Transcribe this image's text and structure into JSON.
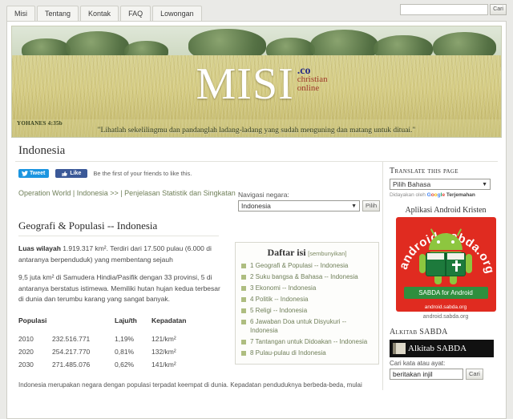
{
  "nav": {
    "tabs": [
      "Misi",
      "Tentang",
      "Kontak",
      "FAQ",
      "Lowongan"
    ],
    "search_value": "",
    "search_placeholder": "",
    "search_button": "Cari"
  },
  "banner": {
    "logo": "MISI",
    "logo_tld": ".co",
    "logo_tagline_1": "christian",
    "logo_tagline_2": "online",
    "verse_ref": "YOHANES 4:35b",
    "verse_text": "\"Lihatlah sekelilingmu dan pandanglah ladang-ladang yang sudah menguning dan matang untuk dituai.\""
  },
  "page": {
    "title": "Indonesia"
  },
  "social": {
    "tweet_label": "Tweet",
    "like_label": "Like",
    "note": "Be the first of your friends to like this."
  },
  "breadcrumb": {
    "item_1": "Operation World",
    "sep_1": " | ",
    "item_2": "Indonesia >>",
    "sep_2": " | ",
    "item_3": "Penjelasan Statistik dan Singkatan"
  },
  "country_nav": {
    "label": "Navigasi negara:",
    "selected": "Indonesia",
    "button": "Pilih"
  },
  "article": {
    "section_title": "Geografi & Populasi -- Indonesia",
    "para1_bold": "Luas wilayah",
    "para1_rest": " 1.919.317 km². Terdiri dari 17.500 pulau (6.000 di antaranya berpenduduk) yang membentang sejauh",
    "para2": "9,5 juta km² di Samudera Hindia/Pasifik dengan 33 provinsi, 5 di antaranya berstatus istimewa. Memiliki hutan hujan kedua terbesar di dunia dan terumbu karang yang sangat banyak.",
    "bottom_para": "Indonesia merupakan negara dengan populasi terpadat keempat di dunia. Kepadatan penduduknya berbeda-beda, mulai"
  },
  "table": {
    "headers": [
      "Populasi",
      "Laju/th",
      "Kepadatan"
    ],
    "rows": [
      {
        "year": "2010",
        "population": "232.516.771",
        "rate": "1,19%",
        "density": "121/km²"
      },
      {
        "year": "2020",
        "population": "254.217.770",
        "rate": "0,81%",
        "density": "132/km²"
      },
      {
        "year": "2030",
        "population": "271.485.076",
        "rate": "0,62%",
        "density": "141/km²"
      }
    ]
  },
  "toc": {
    "title": "Daftar isi",
    "hide_label": "[sembunyikan]",
    "items": [
      "1 Geografi & Populasi -- Indonesia",
      "2 Suku bangsa & Bahasa -- Indonesia",
      "3 Ekonomi -- Indonesia",
      "4 Politik -- Indonesia",
      "5 Religi -- Indonesia",
      "6 Jawaban Doa untuk Disyukuri -- Indonesia",
      "7 Tantangan untuk Didoakan -- Indonesia",
      "8 Pulau-pulau di Indonesia"
    ]
  },
  "sidebar": {
    "translate": {
      "heading": "Translate this page",
      "selected": "Pilih Bahasa",
      "powered_prefix": "Didayakan oleh",
      "google": "Google",
      "powered_suffix": "Terjemahan"
    },
    "android": {
      "heading": "Aplikasi Android Kristen",
      "ring_text": "android.sabda.org",
      "badge": "SABDA for Android",
      "badge_url": "android.sabda.org",
      "caption_url": "android.sabda.org"
    },
    "alkitab": {
      "heading": "Alkitab SABDA",
      "banner_word": "Alkitab SABDA",
      "search_label": "Cari kata atau ayat:",
      "search_value": "beritakan injil",
      "search_button": "Cari"
    }
  },
  "colors": {
    "accent_green": "#6f7f58",
    "bullet": "#aebd80",
    "twitter": "#1b95e0",
    "facebook": "#3b5998",
    "android_red": "#e02b20",
    "android_green": "#8dc63f"
  }
}
